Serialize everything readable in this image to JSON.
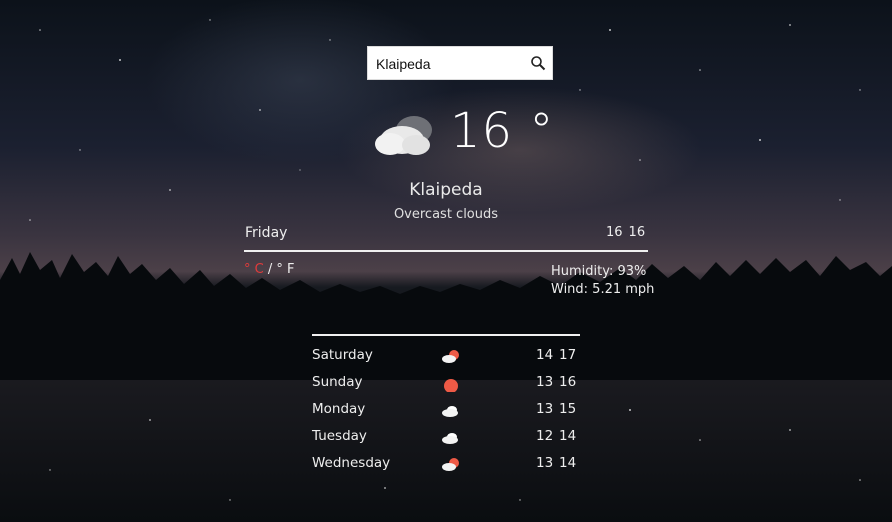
{
  "search": {
    "value": "Klaipeda",
    "icon": "search-icon"
  },
  "current": {
    "icon": "cloud-icon",
    "temperature": "16 °",
    "city": "Klaipeda",
    "description": "Overcast clouds",
    "day": "Friday",
    "min": "16",
    "max": "16",
    "humidity": "Humidity: 93%",
    "wind": "Wind: 5.21 mph"
  },
  "units": {
    "celsius": "° C",
    "separator": "/",
    "fahrenheit": "° F",
    "active_color": "#e23b3b"
  },
  "forecast": [
    {
      "day": "Saturday",
      "icon": "cloud-sun-icon",
      "min": "14",
      "max": "17"
    },
    {
      "day": "Sunday",
      "icon": "sun-icon",
      "min": "13",
      "max": "16"
    },
    {
      "day": "Monday",
      "icon": "cloud-icon",
      "min": "13",
      "max": "15"
    },
    {
      "day": "Tuesday",
      "icon": "cloud-icon",
      "min": "12",
      "max": "14"
    },
    {
      "day": "Wednesday",
      "icon": "cloud-sun-icon",
      "min": "13",
      "max": "14"
    }
  ]
}
